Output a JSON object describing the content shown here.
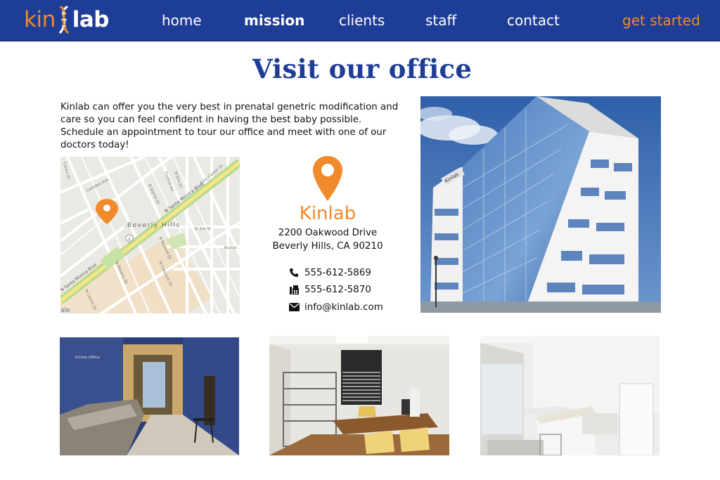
{
  "brand": {
    "logo_left": "kin",
    "logo_right": "lab"
  },
  "nav": {
    "home": "home",
    "mission": "mission",
    "clients": "clients",
    "staff": "staff",
    "contact": "contact",
    "cta": "get started",
    "active": "mission"
  },
  "page": {
    "title": "Visit our office",
    "intro": "Kinlab  can offer you the very best in prenatal genetric modification and care so you can feel confident in having the best baby possible. Schedule an appointment to tour our office and meet with one of our doctors today!"
  },
  "map": {
    "neighborhood": "Beverly Hills",
    "streets": {
      "santa_monica_top": "N Santa Monica Blvd",
      "santa_monica_bottom": "N Santa Monica Blvd",
      "camden": "Camden Ave",
      "elm": "N Elm Dr",
      "foothill": "Foothill Rd",
      "civic": "Civic Center Dr",
      "alpine": "N Alpine Dr",
      "rexford": "N Rexford Dr",
      "crescent": "N Crescent Dr",
      "beverly": "N Beverly Dr",
      "canon": "N Canon Dr",
      "third": "W 3rd St",
      "burton": "Burton",
      "canon_top": "Canon Dr"
    },
    "route_badge": "2",
    "attribution": "ale"
  },
  "office": {
    "name": "Kinlab",
    "address_line1": "2200 Oakwood Drive",
    "address_line2": "Beverly Hills, CA 90210",
    "phone": "555-612-5869",
    "fax": "555-612-5870",
    "email": "info@kinlab.com"
  },
  "photos": {
    "building_sign": "Kinlab",
    "lobby_sign": "Kinlab Office"
  },
  "colors": {
    "navy": "#1e3d96",
    "orange": "#f18a2a"
  },
  "icons": [
    "dna-icon",
    "location-pin-icon",
    "phone-icon",
    "fax-icon",
    "envelope-icon"
  ]
}
